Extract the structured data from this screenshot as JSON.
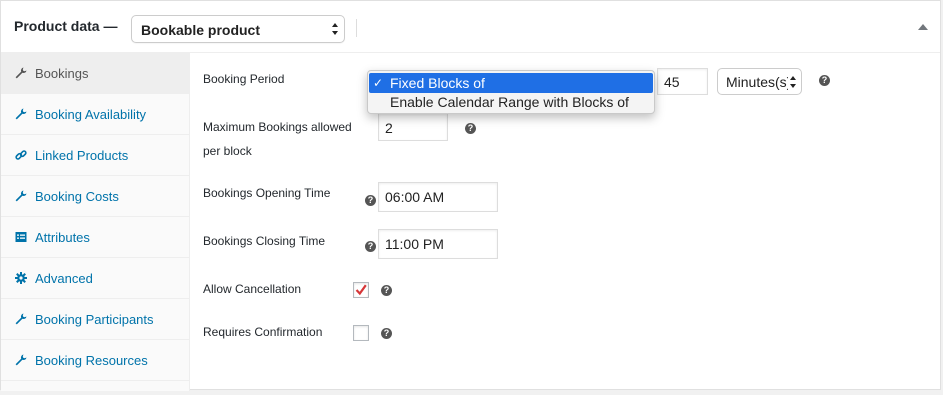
{
  "header": {
    "title": "Product data —",
    "product_type": "Bookable product"
  },
  "sidebar": {
    "items": [
      {
        "label": "Bookings",
        "icon": "wrench-icon",
        "active": true
      },
      {
        "label": "Booking Availability",
        "icon": "wrench-icon",
        "active": false
      },
      {
        "label": "Linked Products",
        "icon": "link-icon",
        "active": false
      },
      {
        "label": "Booking Costs",
        "icon": "wrench-icon",
        "active": false
      },
      {
        "label": "Attributes",
        "icon": "list-icon",
        "active": false
      },
      {
        "label": "Advanced",
        "icon": "gear-icon",
        "active": false
      },
      {
        "label": "Booking Participants",
        "icon": "wrench-icon",
        "active": false
      },
      {
        "label": "Booking Resources",
        "icon": "wrench-icon",
        "active": false
      }
    ]
  },
  "form": {
    "booking_period": {
      "label": "Booking Period",
      "options": [
        "Fixed Blocks of",
        "Enable Calendar Range with Blocks of"
      ],
      "selected": "Fixed Blocks of",
      "duration_value": "45",
      "unit_value": "Minutes(s)"
    },
    "max_bookings": {
      "label_line1": "Maximum Bookings allowed",
      "label_line2": "per block",
      "value": "2"
    },
    "opening_time": {
      "label": "Bookings Opening Time",
      "value": "06:00 AM"
    },
    "closing_time": {
      "label": "Bookings Closing Time",
      "value": "11:00 PM"
    },
    "allow_cancellation": {
      "label": "Allow Cancellation",
      "checked": true
    },
    "requires_confirmation": {
      "label": "Requires Confirmation",
      "checked": false
    },
    "help_glyph": "?"
  },
  "colors": {
    "link": "#0073aa",
    "selected_option": "#1f6fe5",
    "check": "#d63638"
  }
}
